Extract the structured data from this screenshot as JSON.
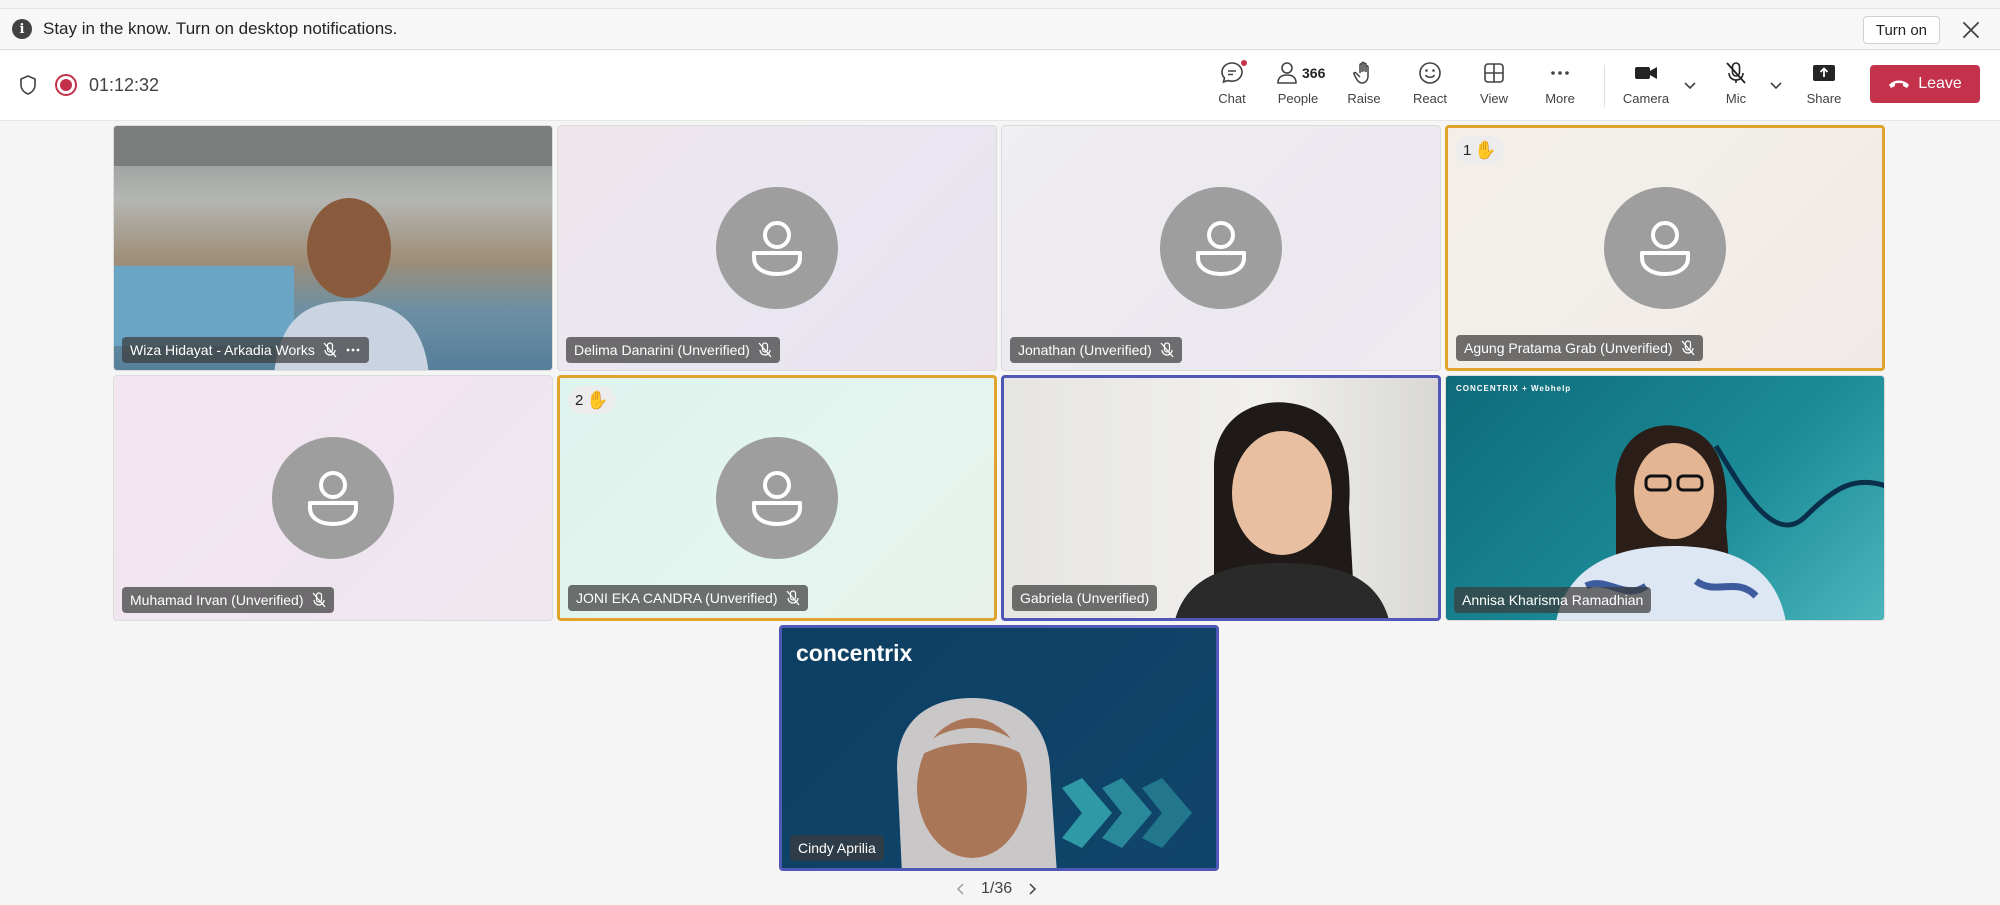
{
  "banner": {
    "message": "Stay in the know. Turn on desktop notifications.",
    "turn_on_label": "Turn on"
  },
  "toolbar": {
    "timer": "01:12:32",
    "chat_label": "Chat",
    "people_label": "People",
    "people_count": "366",
    "raise_label": "Raise",
    "react_label": "React",
    "view_label": "View",
    "more_label": "More",
    "camera_label": "Camera",
    "mic_label": "Mic",
    "share_label": "Share",
    "leave_label": "Leave"
  },
  "participants": [
    {
      "name": "Wiza Hidayat - Arkadia Works"
    },
    {
      "name": "Delima Danarini (Unverified)"
    },
    {
      "name": "Jonathan (Unverified)"
    },
    {
      "name": "Agung Pratama Grab (Unverified)",
      "hand_order": "1"
    },
    {
      "name": "Muhamad Irvan (Unverified)"
    },
    {
      "name": "JONI EKA CANDRA (Unverified)",
      "hand_order": "2"
    },
    {
      "name": "Gabriela (Unverified)"
    },
    {
      "name": "Annisa Kharisma Ramadhian",
      "brand": "CONCENTRIX + Webhelp"
    },
    {
      "name": "Cindy Aprilia",
      "brand": "concentrix"
    }
  ],
  "pager": {
    "text": "1/36"
  },
  "colors": {
    "leave": "#c4314b",
    "raised_hand_border": "#e0a32c",
    "speaking_border": "#5157b6"
  }
}
